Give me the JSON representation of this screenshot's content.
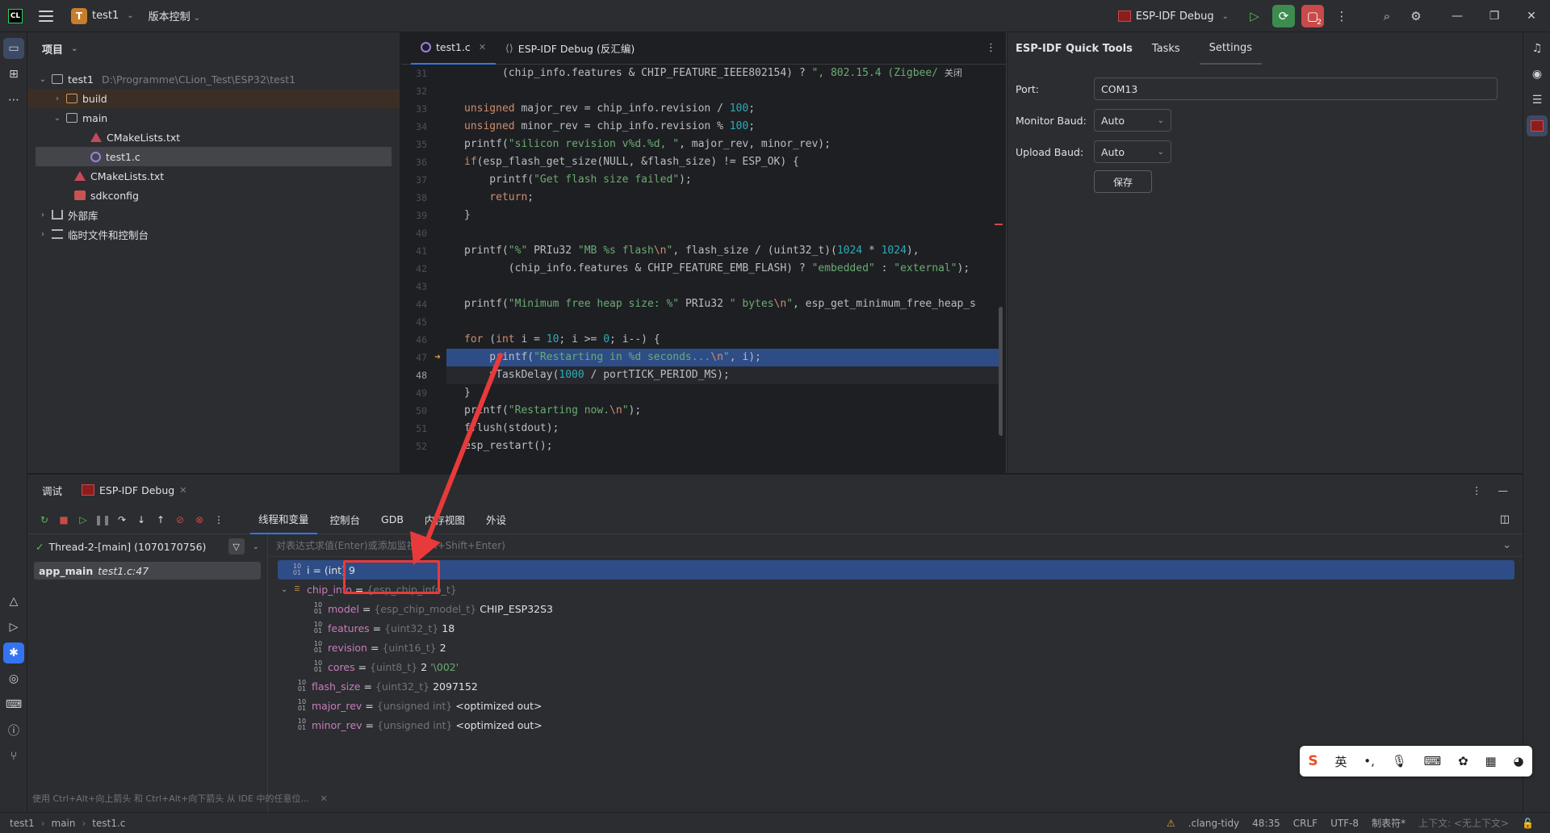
{
  "titlebar": {
    "app_logo": "CL",
    "project_badge": "T",
    "project_name": "test1",
    "vcs_label": "版本控制",
    "run_config": "ESP-IDF Debug",
    "red_sub": "2"
  },
  "project": {
    "header": "项目",
    "root_name": "test1",
    "root_path": "D:\\Programme\\CLion_Test\\ESP32\\test1",
    "items": {
      "build": "build",
      "main": "main",
      "main_cmake": "CMakeLists.txt",
      "test1c": "test1.c",
      "root_cmake": "CMakeLists.txt",
      "sdkconfig": "sdkconfig",
      "external": "外部库",
      "scratches": "临时文件和控制台"
    }
  },
  "editor": {
    "tabs": [
      "test1.c",
      "ESP-IDF Debug (反汇编)"
    ],
    "close_hint": "关闭",
    "lines": {
      "n31": "31",
      "n32": "32",
      "n33": "33",
      "n34": "34",
      "n35": "35",
      "n36": "36",
      "n37": "37",
      "n38": "38",
      "n39": "39",
      "n40": "40",
      "n41": "41",
      "n42": "42",
      "n43": "43",
      "n44": "44",
      "n45": "45",
      "n46": "46",
      "n47": "47",
      "n48": "48",
      "n49": "49",
      "n50": "50",
      "n51": "51",
      "n52": "52"
    }
  },
  "quicktools": {
    "title": "ESP-IDF Quick Tools",
    "tab_tasks": "Tasks",
    "tab_settings": "Settings",
    "port_label": "Port:",
    "port_value": "COM13",
    "monitor_label": "Monitor Baud:",
    "monitor_value": "Auto",
    "upload_label": "Upload Baud:",
    "upload_value": "Auto",
    "save_label": "保存"
  },
  "debug": {
    "tab_debug": "调试",
    "tab_session": "ESP-IDF Debug",
    "view_tabs": [
      "线程和变量",
      "控制台",
      "GDB",
      "内存视图",
      "外设"
    ],
    "thread": "Thread-2-[main] (1070170756)",
    "frame_name": "app_main",
    "frame_loc": "test1.c:47",
    "hint": "使用 Ctrl+Alt+向上箭头 和 Ctrl+Alt+向下箭头 从 IDE 中的任意位...",
    "expr_placeholder": "对表达式求值(Enter)或添加监视(Ctrl+Shift+Enter)",
    "vars": {
      "i": {
        "name": "i",
        "type": "(int)",
        "value": "9"
      },
      "chip_info": {
        "name": "chip_info",
        "type": "{esp_chip_info_t}"
      },
      "model": {
        "name": "model",
        "type": "{esp_chip_model_t}",
        "value": "CHIP_ESP32S3"
      },
      "features": {
        "name": "features",
        "type": "{uint32_t}",
        "value": "18"
      },
      "revision": {
        "name": "revision",
        "type": "{uint16_t}",
        "value": "2"
      },
      "cores": {
        "name": "cores",
        "type": "{uint8_t}",
        "value": "2",
        "extra": "'\\002'"
      },
      "flash_size": {
        "name": "flash_size",
        "type": "{uint32_t}",
        "value": "2097152"
      },
      "major_rev": {
        "name": "major_rev",
        "type": "{unsigned int}",
        "value": "<optimized out>"
      },
      "minor_rev": {
        "name": "minor_rev",
        "type": "{unsigned int}",
        "value": "<optimized out>"
      }
    }
  },
  "ime": {
    "lang": "英",
    "punct": "•,",
    "logo": "S"
  },
  "status": {
    "crumb_project": "test1",
    "crumb_dir": "main",
    "crumb_file": "test1.c",
    "inspector": ".clang-tidy",
    "position": "48:35",
    "line_sep": "CRLF",
    "encoding": "UTF-8",
    "indent": "制表符*",
    "context": "上下文: <无上下文>"
  },
  "colors": {
    "accent": "#3574f0",
    "exec_line": "#2e4d87",
    "annotation": "#e83a3a"
  }
}
